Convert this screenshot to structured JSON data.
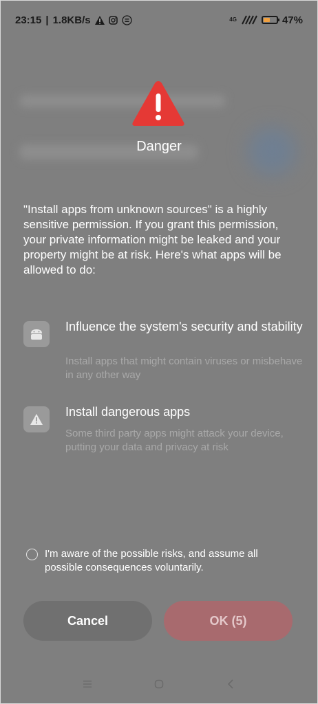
{
  "status_bar": {
    "time": "23:15",
    "separator": "|",
    "speed": "1.8KB/s",
    "network": "4G",
    "battery": "47%"
  },
  "dialog": {
    "title": "Danger",
    "description": "\"Install apps from unknown sources\" is a highly sensitive permission. If you grant this permission, your private information might be leaked and your property might be at risk. Here's what apps will be allowed to do:",
    "permissions": [
      {
        "icon": "android-icon",
        "title": "Influence the system's security and stability",
        "subtitle": "Install apps that might contain viruses or misbehave in any other way"
      },
      {
        "icon": "warning-icon",
        "title": "Install dangerous apps",
        "subtitle": "Some third party apps might attack your device, putting your data and privacy at risk"
      }
    ],
    "consent_text": "I'm aware of the possible risks, and assume all possible consequences voluntarily.",
    "cancel_label": "Cancel",
    "ok_label": "OK (5)"
  },
  "colors": {
    "danger_red": "#e53935",
    "background": "#7f7f7f",
    "ok_button": "#a86a6e",
    "cancel_button": "#707070"
  }
}
